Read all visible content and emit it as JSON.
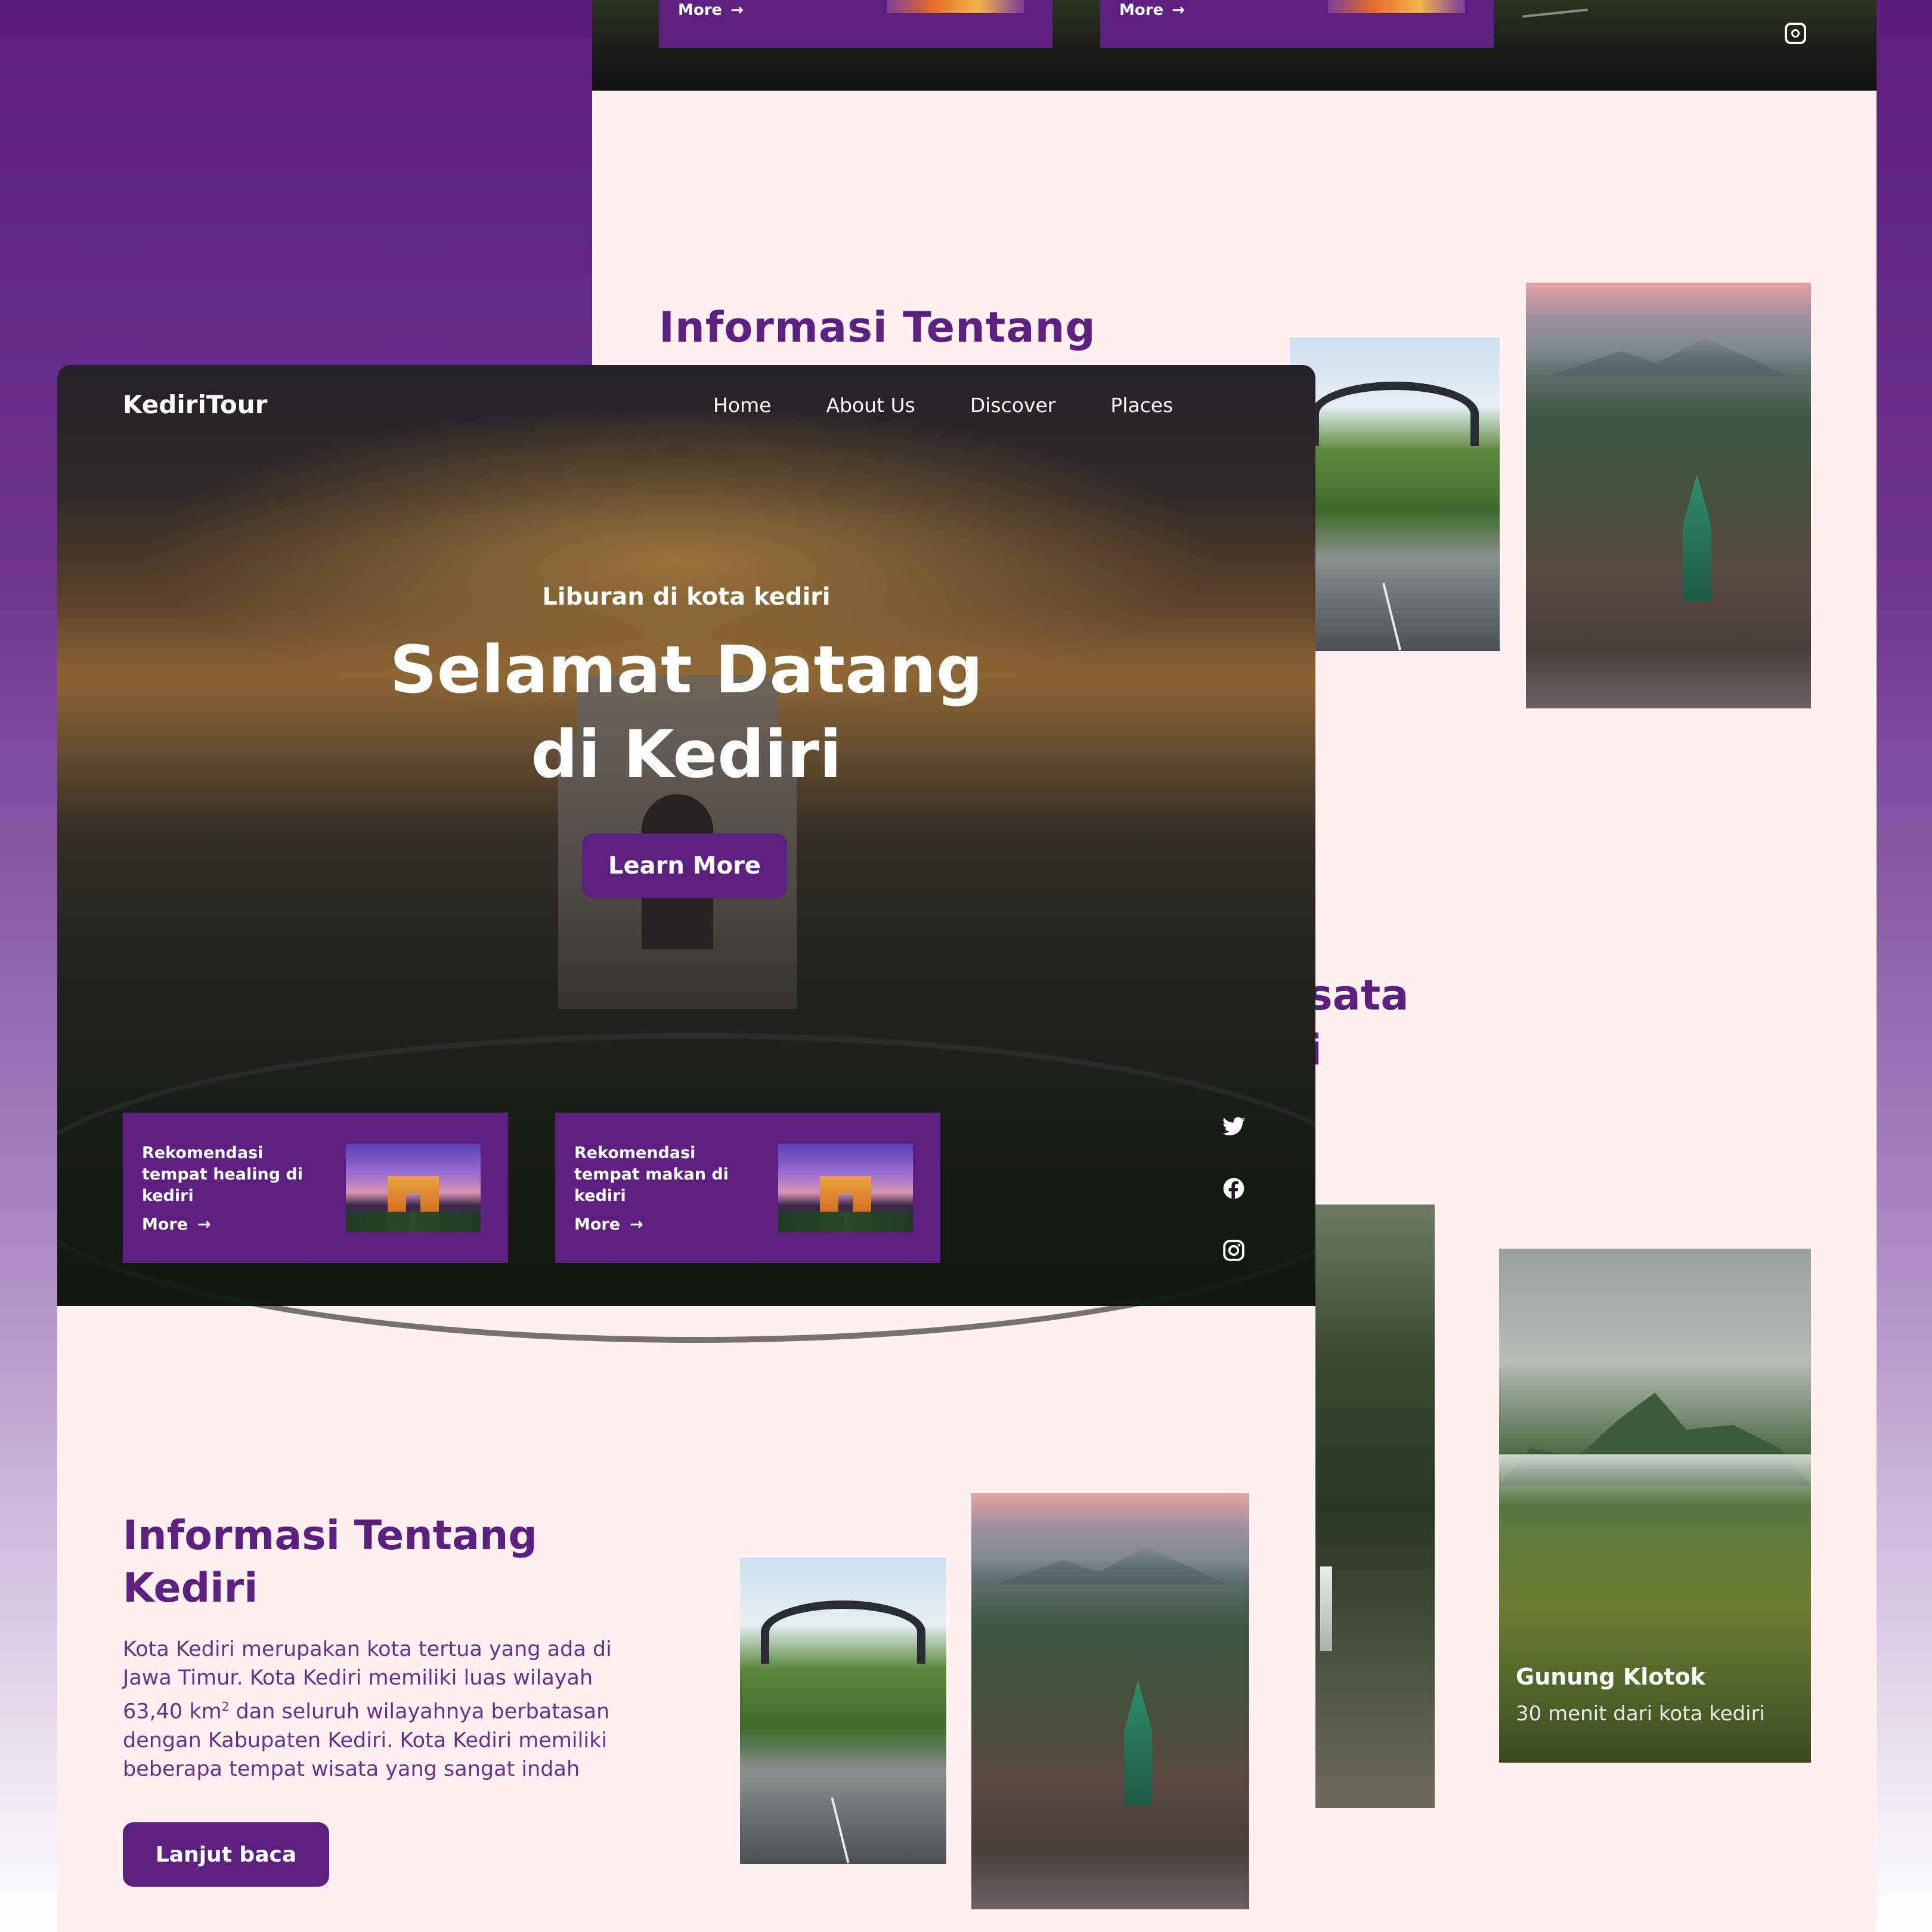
{
  "brand": {
    "name": "KediriTour",
    "accent": "#5d1f80",
    "background": "#fff1f1"
  },
  "nav": {
    "items": [
      "Home",
      "About Us",
      "Discover",
      "Places"
    ]
  },
  "hero": {
    "subtitle": "Liburan di kota kediri",
    "title_line1": "Selamat Datang",
    "title_line2": "di Kediri",
    "cta": "Learn More"
  },
  "cards": [
    {
      "label": "Rekomendasi tempat healing di kediri",
      "more": "More",
      "arrow": "→"
    },
    {
      "label": "Rekomendasi tempat makan di kediri",
      "more": "More",
      "arrow": "→"
    }
  ],
  "social": {
    "icons": [
      "twitter-icon",
      "facebook-icon",
      "instagram-icon"
    ]
  },
  "info": {
    "title_line1": "Informasi Tentang",
    "title_line2": "Kediri",
    "text_before_sup": "Kota Kediri merupakan kota tertua yang ada di Jawa Timur. Kota Kediri memiliki luas wilayah 63,40 km",
    "sup": "2",
    "text_after_sup": " dan seluruh wilayahnya berbatasan dengan Kabupaten Kediri. Kota Kediri memiliki beberapa tempat wisata yang sangat indah",
    "button": "Lanjut baca"
  },
  "back": {
    "more": "More",
    "arrow": "→",
    "heading": "Informasi Tentang",
    "partial_heading_1": "sata",
    "partial_heading_2": "i",
    "place_title": "Gunung Klotok",
    "place_sub": "30 menit dari kota kediri"
  }
}
